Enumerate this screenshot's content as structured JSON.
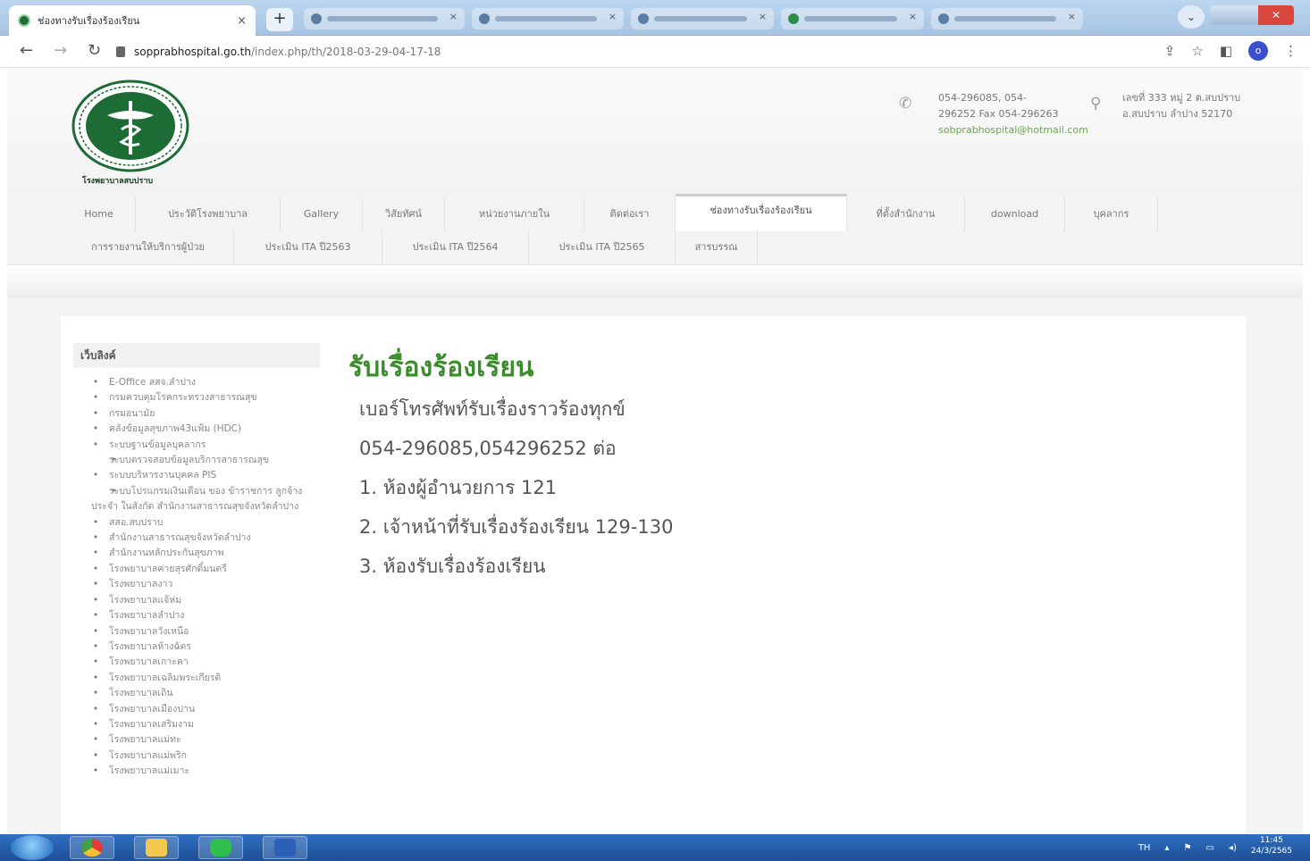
{
  "browser": {
    "tab_title": "ช่องทางรับเรื่องร้องเรียน",
    "tab_close": "×",
    "new_tab": "+",
    "url_host": "sopprabhospital.go.th",
    "url_path": "/index.php/th/2018-03-29-04-17-18",
    "profile_initial": "o"
  },
  "header": {
    "logo_caption": "โรงพยาบาลสบปราบ",
    "phone": "054-296085, 054-296252 Fax 054-296263",
    "email": "sobprabhospital@hotmail.com",
    "address": "เลขที่ 333 หมู่ 2 ต.สบปราบ อ.สบปราบ ลำปาง 52170"
  },
  "nav": {
    "row1": [
      "Home",
      "ประวัติโรงพยาบาล",
      "Gallery",
      "วิสัยทัศน์",
      "หน่วยงานภายใน",
      "ติดต่อเรา",
      "ช่องทางรับเรื่องร้องเรียน",
      "ที่ตั้งสำนักงาน",
      "download",
      "บุคลากร"
    ],
    "row2": [
      "การรายงานให้บริการผู้ป่วย",
      "ประเมิน ITA ปี2563",
      "ประเมิน ITA ปี2564",
      "ประเมิน ITA ปี2565",
      "สารบรรณ"
    ]
  },
  "sidebar": {
    "title": "เว็บลิงค์",
    "links": [
      "E-Office สสจ.ลำปาง",
      "กรมควบคุมโรคกระทรวงสาธารณสุข",
      "กรมอนามัย",
      "คลังข้อมูลสุขภาพ43แฟ้ม (HDC)",
      "ระบบฐานข้อมูลบุคลากร",
      "ระบบตรวจสอบข้อมูลบริการสาธารณสุข",
      "ระบบบริหารงานบุคคล PIS",
      "ระบบโปรแกรมเงินเดือน ของ ข้าราชการ ลูกจ้างประจำ ในสังกัด สำนักงานสาธารณสุขจังหวัดลำปาง",
      "สสอ.สบปราบ",
      "สำนักงานสาธารณสุขจังหวัดลำปาง",
      "สำนักงานหลักประกันสุขภาพ",
      "โรงพยาบาลค่ายสุรศักดิ์มนตรี",
      "โรงพยาบาลงาว",
      "โรงพยาบาลแจ้ห่ม",
      "โรงพยาบาลลำปาง",
      "โรงพยาบาลวังเหนือ",
      "โรงพยาบาลห้างฉัตร",
      "โรงพยาบาลเกาะคา",
      "โรงพยาบาลเฉลิมพระเกียรติ",
      "โรงพยาบาลเถิน",
      "โรงพยาบาลเมืองปาน",
      "โรงพยาบาลเสริมงาม",
      "โรงพยาบาลแม่ทะ",
      "โรงพยาบาลแม่พริก",
      "โรงพยาบาลแม่เมาะ"
    ]
  },
  "content": {
    "title": "รับเรื่องร้องเรียน",
    "lines": [
      "เบอร์โทรศัพท์รับเรื่องราวร้องทุกข์",
      "054-296085,054296252 ต่อ",
      "1. ห้องผู้อำนวยการ 121",
      "2. เจ้าหน้าที่รับเรื่องร้องเรียน 129-130",
      "3. ห้องรับเรื่องร้องเรียน"
    ]
  },
  "taskbar": {
    "lang": "TH",
    "time": "11:45",
    "date": "24/3/2565"
  }
}
